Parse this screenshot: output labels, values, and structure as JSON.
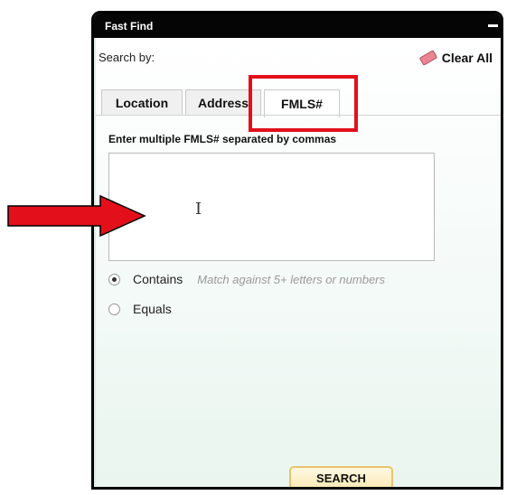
{
  "window": {
    "title": "Fast Find"
  },
  "search_by_label": "Search by:",
  "clear_all_label": "Clear All",
  "tabs": [
    {
      "label": "Location",
      "active": false
    },
    {
      "label": "Address",
      "active": false
    },
    {
      "label": "FMLS#",
      "active": true
    }
  ],
  "instruction": "Enter multiple FMLS# separated by commas",
  "fmls_input": {
    "value": ""
  },
  "match_options": [
    {
      "label": "Contains",
      "hint": "Match against 5+ letters or numbers",
      "selected": true
    },
    {
      "label": "Equals",
      "hint": "",
      "selected": false
    }
  ],
  "search_button_label": "SEARCH",
  "colors": {
    "titlebar": "#050505",
    "annotation_red": "#e3101b",
    "button_border": "#e7c46a"
  },
  "icons": {
    "clear": "eraser-icon",
    "minimize": "minimize-icon",
    "cursor": "text-cursor-icon",
    "annotation": "red-arrow-icon"
  }
}
